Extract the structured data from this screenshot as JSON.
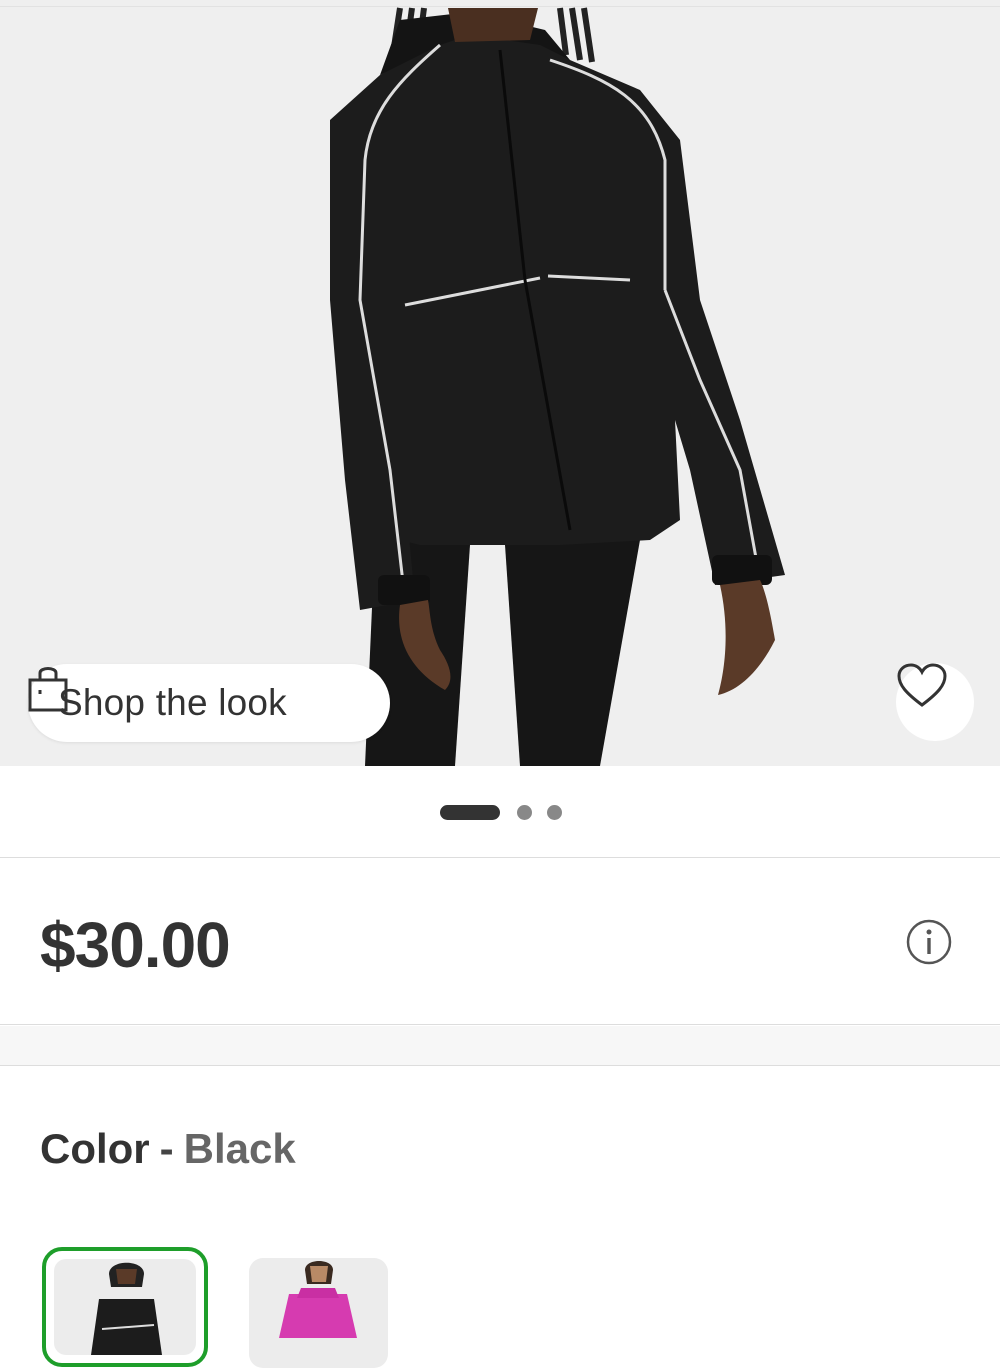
{
  "product": {
    "shop_the_look_label": "Shop the look",
    "price": "$30.00",
    "carousel": {
      "total": 3,
      "active_index": 0
    },
    "favorite_icon": "heart-icon",
    "info_icon": "info-icon",
    "bag_icon": "shopping-bag-icon"
  },
  "color": {
    "label": "Color",
    "separator": "-",
    "selected": "Black",
    "options": [
      {
        "name": "Black",
        "selected": true,
        "accent": "#1e9e2a"
      },
      {
        "name": "Pink",
        "selected": false
      }
    ]
  },
  "colors": {
    "text_primary": "#333333",
    "selection_border": "#1e9e2a",
    "jacket": "#1c1c1c",
    "pink_option": "#d63bb0"
  }
}
